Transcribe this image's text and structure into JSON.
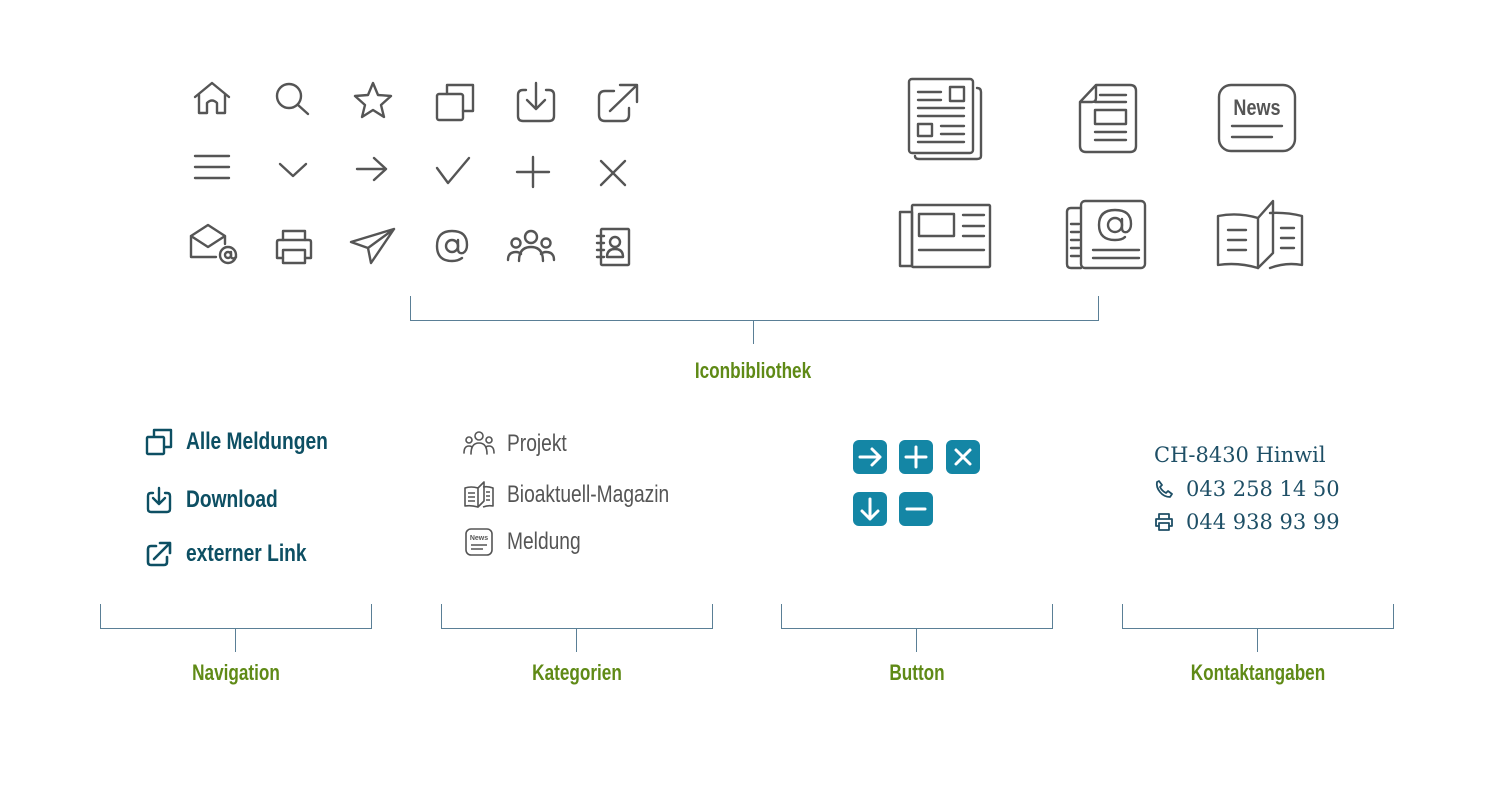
{
  "icon_library": {
    "label": "Iconbibliothek",
    "small_icons": [
      "home-icon",
      "search-icon",
      "star-icon",
      "copy-icon",
      "download-icon",
      "external-link-icon",
      "menu-icon",
      "chevron-down-icon",
      "arrow-right-icon",
      "check-icon",
      "plus-icon",
      "close-icon",
      "mail-at-icon",
      "printer-icon",
      "send-icon",
      "at-icon",
      "group-icon",
      "address-book-icon"
    ],
    "large_icons": [
      "newspaper-stack-icon",
      "document-icon",
      "news-badge-icon",
      "newspaper-icon",
      "newsletter-at-icon",
      "magazine-icon"
    ],
    "news_badge_text": "News"
  },
  "sections": {
    "navigation": {
      "label": "Navigation",
      "items": [
        {
          "label": "Alle Meldungen",
          "icon": "copy-icon"
        },
        {
          "label": "Download",
          "icon": "download-icon"
        },
        {
          "label": "externer Link",
          "icon": "external-link-icon"
        }
      ]
    },
    "kategorien": {
      "label": "Kategorien",
      "items": [
        {
          "label": "Projekt",
          "icon": "group-icon"
        },
        {
          "label": "Bioaktuell-Magazin",
          "icon": "magazine-icon"
        },
        {
          "label": "Meldung",
          "icon": "news-badge-icon"
        }
      ]
    },
    "button": {
      "label": "Button",
      "buttons": [
        "arrow-right-icon",
        "plus-icon",
        "close-icon",
        "arrow-down-icon",
        "minus-icon"
      ]
    },
    "kontakt": {
      "label": "Kontaktangaben",
      "address": "CH-8430 Hinwil",
      "phone": "043 258 14 50",
      "fax": "044 938 93 99"
    }
  },
  "colors": {
    "icon_gray": "#555555",
    "nav_teal": "#0d4f63",
    "button_blue": "#1486a5",
    "label_green": "#5f8a16",
    "bracket": "#5a7f96",
    "contact": "#1e4f66"
  }
}
